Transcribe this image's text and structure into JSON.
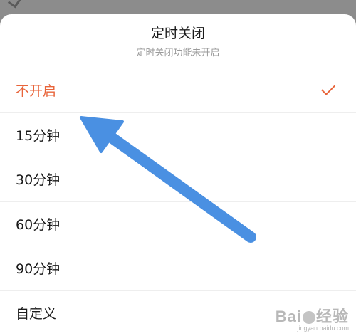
{
  "sheet": {
    "title": "定时关闭",
    "subtitle": "定时关闭功能未开启",
    "options": [
      {
        "label": "不开启",
        "selected": true
      },
      {
        "label": "15分钟",
        "selected": false
      },
      {
        "label": "30分钟",
        "selected": false
      },
      {
        "label": "60分钟",
        "selected": false
      },
      {
        "label": "90分钟",
        "selected": false
      },
      {
        "label": "自定义",
        "selected": false
      }
    ]
  },
  "watermark": {
    "brand_left": "Bai",
    "brand_right": "经验",
    "url": "jingyan.baidu.com"
  },
  "colors": {
    "accent": "#e8643a",
    "annotation_arrow": "#4a90e2"
  },
  "icons": {
    "selected_marker": "checkmark-icon",
    "annotation": "arrow-icon"
  }
}
